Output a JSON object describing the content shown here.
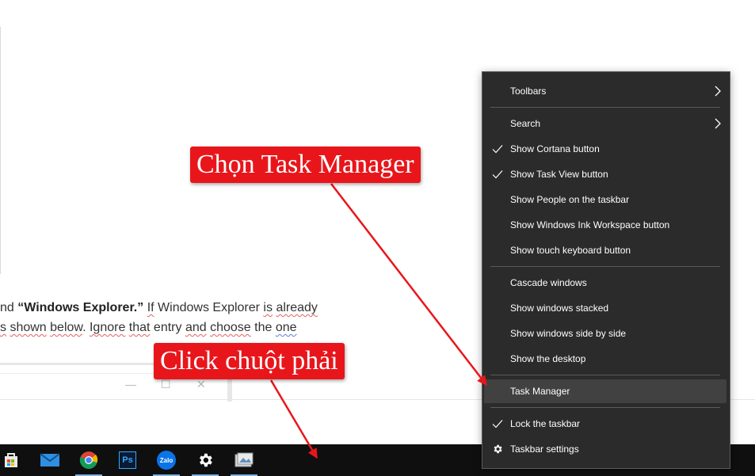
{
  "document": {
    "line1": {
      "prefix": "nd ",
      "bold": "“Windows Explorer.”",
      "w1": "If",
      "w2": " Windows Explorer ",
      "w3": "is",
      "w4": " ",
      "w5": "already"
    },
    "line2": {
      "w1": "s",
      "w2": " ",
      "w3": "shown",
      "w4": " ",
      "w5": "below",
      "w6": ". ",
      "w7": "Ignore",
      "w8": " ",
      "w9": "that",
      "w10": " entry ",
      "w11": "and",
      "w12": " ",
      "w13": "choose",
      "w14": " the ",
      "w15": "one"
    },
    "window_controls": {
      "minimize": "—",
      "maximize": "☐",
      "close": "✕"
    }
  },
  "context_menu": {
    "items": [
      {
        "label": "Toolbars",
        "checked": false,
        "submenu": true
      },
      {
        "label": "Search",
        "checked": false,
        "submenu": true
      },
      {
        "label": "Show Cortana button",
        "checked": true,
        "submenu": false
      },
      {
        "label": "Show Task View button",
        "checked": true,
        "submenu": false
      },
      {
        "label": "Show People on the taskbar",
        "checked": false,
        "submenu": false
      },
      {
        "label": "Show Windows Ink Workspace button",
        "checked": false,
        "submenu": false
      },
      {
        "label": "Show touch keyboard button",
        "checked": false,
        "submenu": false
      },
      {
        "label": "Cascade windows",
        "checked": false,
        "submenu": false
      },
      {
        "label": "Show windows stacked",
        "checked": false,
        "submenu": false
      },
      {
        "label": "Show windows side by side",
        "checked": false,
        "submenu": false
      },
      {
        "label": "Show the desktop",
        "checked": false,
        "submenu": false
      },
      {
        "label": "Task Manager",
        "checked": false,
        "submenu": false,
        "highlighted": true
      },
      {
        "label": "Lock the taskbar",
        "checked": true,
        "submenu": false
      },
      {
        "label": "Taskbar settings",
        "checked": false,
        "submenu": false,
        "icon": "gear-icon"
      }
    ]
  },
  "callouts": {
    "task_manager": "Chọn Task Manager",
    "right_click": "Click chuột phải"
  },
  "taskbar": {
    "icons": [
      {
        "name": "store-icon"
      },
      {
        "name": "mail-icon"
      },
      {
        "name": "chrome-icon"
      },
      {
        "name": "photoshop-icon",
        "text": "Ps"
      },
      {
        "name": "zalo-icon",
        "text": "Zalo"
      },
      {
        "name": "settings-gear-icon"
      },
      {
        "name": "photos-icon"
      }
    ]
  },
  "colors": {
    "callout_red": "#e8161b",
    "menu_bg": "#2b2b2b",
    "menu_highlight": "#414141",
    "taskbar_bg": "#0f0f0f",
    "active_indicator": "#7fb2e0"
  }
}
